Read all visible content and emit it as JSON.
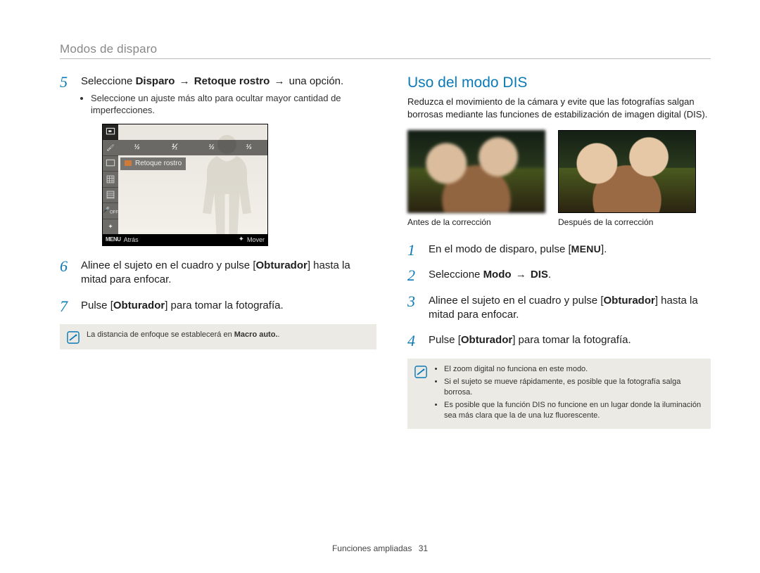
{
  "section_title": "Modos de disparo",
  "left": {
    "step5": {
      "prefix": "Seleccione ",
      "bold1": "Disparo",
      "arrow1": "→",
      "bold2": "Retoque rostro",
      "arrow2": "→",
      "suffix": " una opción.",
      "bullet": "Seleccione un ajuste más alto para ocultar mayor cantidad de imperfecciones."
    },
    "lcd": {
      "label": "Retoque rostro",
      "back": "Atrás",
      "menu": "MENU",
      "move": "Mover",
      "intensity": [
        "½",
        "⅟₁",
        "½",
        "⅓"
      ]
    },
    "step6": {
      "t1": "Alinee el sujeto en el cuadro y pulse [",
      "b": "Obturador",
      "t2": "] hasta la mitad para enfocar."
    },
    "step7": {
      "t1": "Pulse [",
      "b": "Obturador",
      "t2": "] para tomar la fotografía."
    },
    "note": {
      "t1": "La distancia de enfoque se establecerá en ",
      "b": "Macro auto.",
      "t2": "."
    }
  },
  "right": {
    "title": "Uso del modo DIS",
    "intro": "Reduzca el movimiento de la cámara y evite que las fotografías salgan borrosas mediante las funciones de estabilización de imagen digital (DIS).",
    "cap_before": "Antes de la corrección",
    "cap_after": "Después de la corrección",
    "step1": {
      "t1": "En el modo de disparo, pulse [",
      "menu": "MENU",
      "t2": "]."
    },
    "step2": {
      "t1": "Seleccione ",
      "b1": "Modo",
      "arrow": "→",
      "b2": "DIS",
      "t2": "."
    },
    "step3": {
      "t1": "Alinee el sujeto en el cuadro y pulse [",
      "b": "Obturador",
      "t2": "] hasta la mitad para enfocar."
    },
    "step4": {
      "t1": "Pulse [",
      "b": "Obturador",
      "t2": "] para tomar la fotografía."
    },
    "notes": [
      "El zoom digital no funciona en este modo.",
      "Si el sujeto se mueve rápidamente, es posible que la fotografía salga borrosa.",
      "Es posible que la función DIS no funcione en un lugar donde la iluminación sea más clara que la de una luz fluorescente."
    ]
  },
  "footer": {
    "label": "Funciones ampliadas",
    "page": "31"
  }
}
